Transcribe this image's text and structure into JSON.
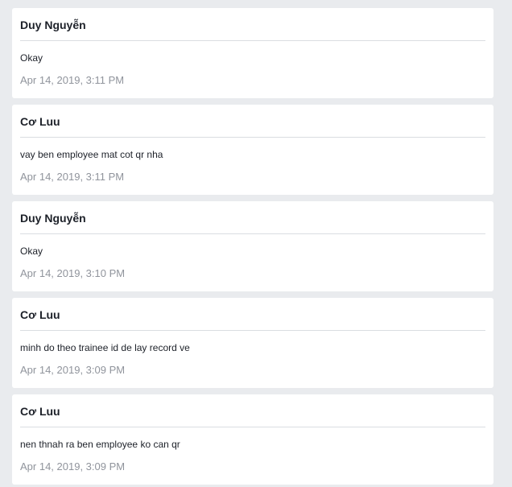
{
  "comments": [
    {
      "author": "Duy Nguyễn",
      "message": "Okay",
      "timestamp": "Apr 14, 2019, 3:11 PM"
    },
    {
      "author": "Cơ Luu",
      "message": "vay ben employee mat cot qr nha",
      "timestamp": "Apr 14, 2019, 3:11 PM"
    },
    {
      "author": "Duy Nguyễn",
      "message": "Okay",
      "timestamp": "Apr 14, 2019, 3:10 PM"
    },
    {
      "author": "Cơ Luu",
      "message": "minh do theo trainee id de lay record ve",
      "timestamp": "Apr 14, 2019, 3:09 PM"
    },
    {
      "author": "Cơ Luu",
      "message": "nen thnah ra ben employee ko can qr",
      "timestamp": "Apr 14, 2019, 3:09 PM"
    }
  ]
}
